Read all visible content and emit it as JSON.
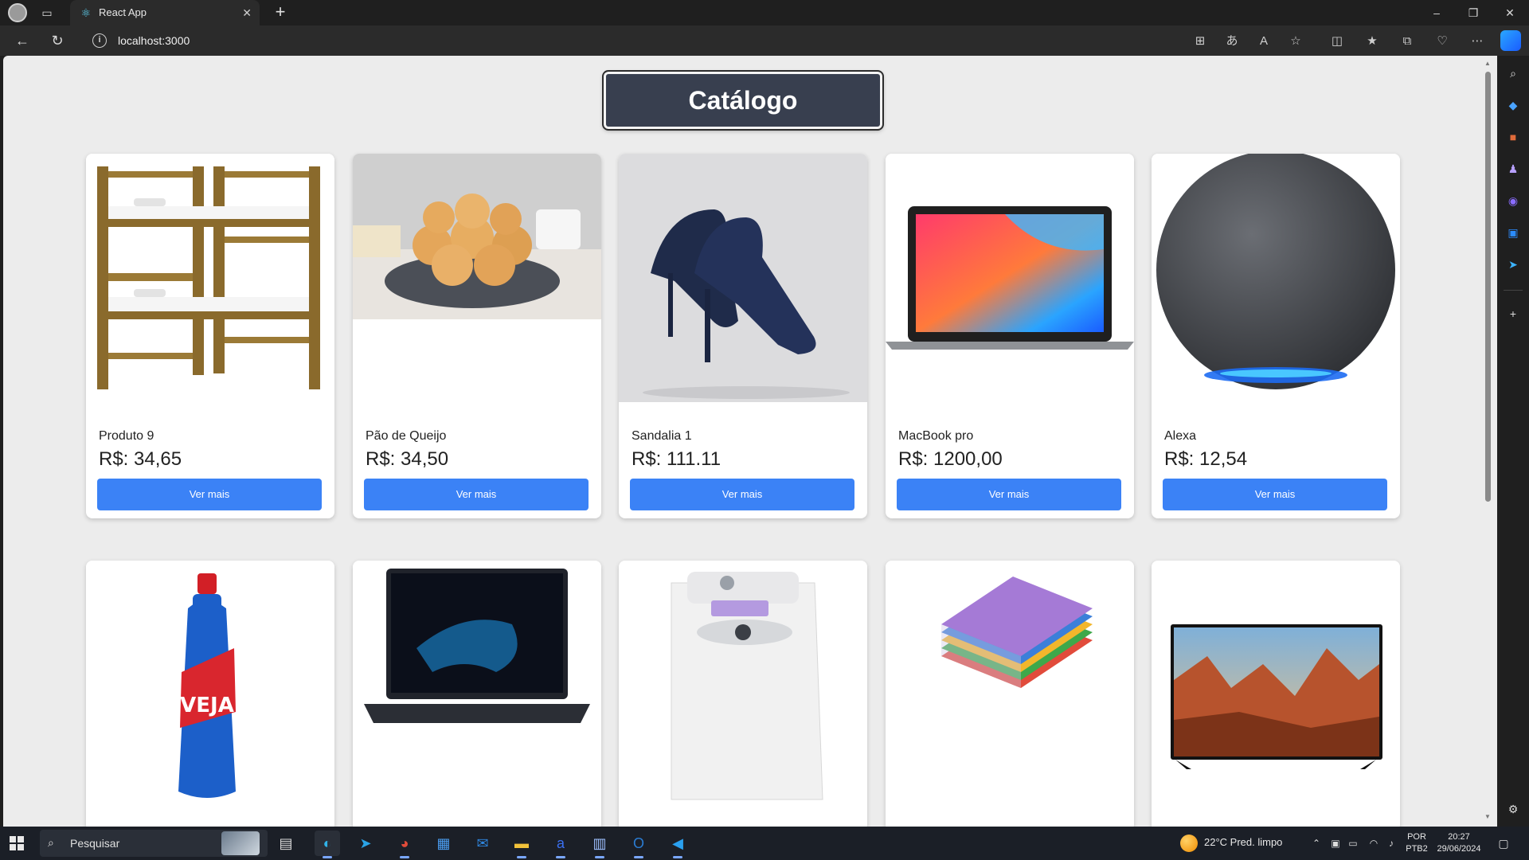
{
  "browser": {
    "tab_title": "React App",
    "url": "localhost:3000",
    "new_tab_symbol": "+",
    "close_symbol": "✕",
    "minimize_symbol": "–",
    "restore_symbol": "❐",
    "window_close_symbol": "✕"
  },
  "page": {
    "title": "Catálogo"
  },
  "products": [
    {
      "name": "Produto 9",
      "price": "R$: 34,65",
      "button": "Ver mais",
      "image": "bunk-bed"
    },
    {
      "name": "Pão de Queijo",
      "price": "R$: 34,50",
      "button": "Ver mais",
      "image": "cheese-bread"
    },
    {
      "name": "Sandalia 1",
      "price": "R$: 111.11",
      "button": "Ver mais",
      "image": "navy-heels"
    },
    {
      "name": "MacBook pro",
      "price": "R$: 1200,00",
      "button": "Ver mais",
      "image": "laptop-macbook"
    },
    {
      "name": "Alexa",
      "price": "R$: 12,54",
      "button": "Ver mais",
      "image": "smart-speaker"
    },
    {
      "image": "cleaning-bottle"
    },
    {
      "image": "laptop-dark"
    },
    {
      "image": "washing-machine"
    },
    {
      "image": "notebooks"
    },
    {
      "image": "television"
    }
  ],
  "taskbar": {
    "search_placeholder": "Pesquisar",
    "weather": "22°C  Pred. limpo",
    "lang_line1": "POR",
    "lang_line2": "PTB2",
    "time": "20:27",
    "date": "29/06/2024"
  },
  "colors": {
    "title_bg": "#383f4f",
    "button_blue": "#3b82f6",
    "page_bg": "#ececec"
  }
}
